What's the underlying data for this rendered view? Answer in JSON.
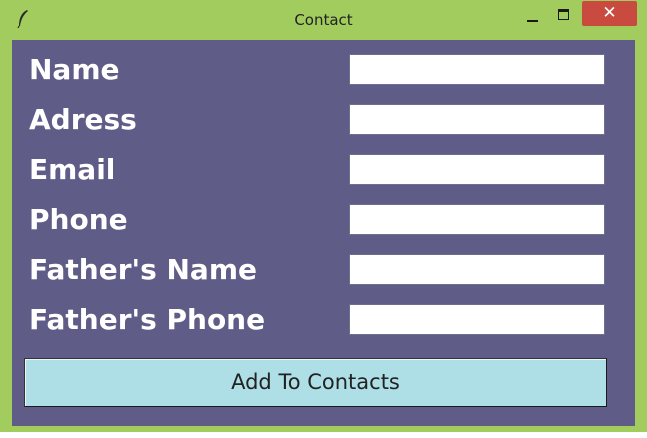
{
  "window": {
    "title": "Contact",
    "app_icon": "feather-icon",
    "controls": {
      "minimize_icon": "minimize-icon",
      "maximize_icon": "maximize-icon",
      "close_label": "✕"
    }
  },
  "form": {
    "fields": [
      {
        "label": "Name",
        "value": ""
      },
      {
        "label": "Adress",
        "value": ""
      },
      {
        "label": "Email",
        "value": ""
      },
      {
        "label": "Phone",
        "value": ""
      },
      {
        "label": "Father's Name",
        "value": ""
      },
      {
        "label": "Father's Phone",
        "value": ""
      }
    ],
    "submit_label": "Add To Contacts"
  },
  "colors": {
    "frame": "#a2cc5e",
    "panel": "#5f5c87",
    "button": "#aedfe6",
    "close": "#c94a3e"
  }
}
